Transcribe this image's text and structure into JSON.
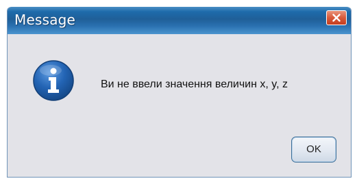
{
  "dialog": {
    "title": "Message",
    "message": "Ви не ввели значення величин x, y, z",
    "icon": "info-icon",
    "ok_label": "OK",
    "close_icon": "close-icon"
  },
  "colors": {
    "titlebar": "#1f5f98",
    "background": "#e3e3e8",
    "icon": "#1f5da8",
    "close_button": "#d85a3a"
  }
}
